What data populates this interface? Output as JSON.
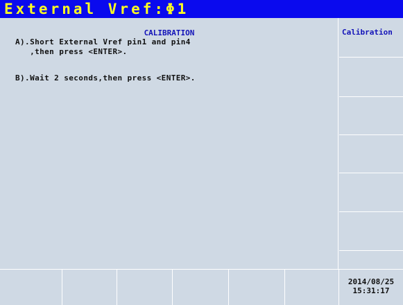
{
  "header": {
    "title": "External Vref:Φ1"
  },
  "main": {
    "section_title": "CALIBRATION",
    "instructions": [
      "A).Short External Vref pin1 and pin4",
      "   ,then press <ENTER>.",
      "B).Wait 2 seconds,then press <ENTER>."
    ]
  },
  "softkeys": [
    {
      "label": "Calibration"
    },
    {
      "label": ""
    },
    {
      "label": ""
    },
    {
      "label": ""
    },
    {
      "label": ""
    },
    {
      "label": ""
    }
  ],
  "function_keys": [
    "",
    "",
    "",
    "",
    "",
    ""
  ],
  "status": {
    "date": "2014/08/25",
    "time": "15:31:17"
  },
  "colors": {
    "title_bar": "#0a0aee",
    "title_text": "#ffff20",
    "background": "#cfd9e4",
    "accent_text": "#1212b8"
  }
}
